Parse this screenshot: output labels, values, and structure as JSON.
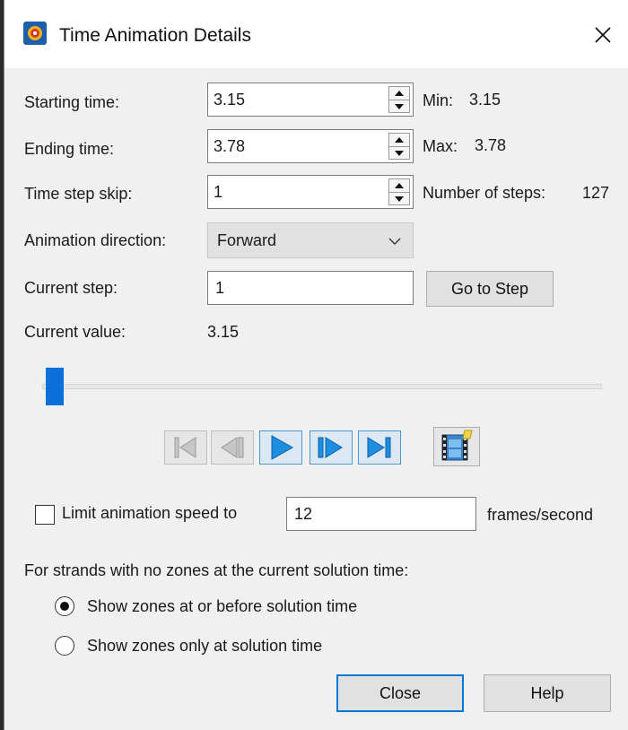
{
  "window": {
    "title": "Time Animation Details",
    "close_icon": "close-icon"
  },
  "fields": {
    "starting_time_label": "Starting time:",
    "starting_time_value": "3.15",
    "min_label": "Min:",
    "min_value": "3.15",
    "ending_time_label": "Ending time:",
    "ending_time_value": "3.78",
    "max_label": "Max:",
    "max_value": "3.78",
    "time_step_skip_label": "Time step skip:",
    "time_step_skip_value": "1",
    "num_steps_label": "Number of steps:",
    "num_steps_value": "127",
    "direction_label": "Animation direction:",
    "direction_value": "Forward",
    "current_step_label": "Current step:",
    "current_step_value": "1",
    "go_to_step_label": "Go to Step",
    "current_value_label": "Current value:",
    "current_value_value": "3.15"
  },
  "slider": {
    "position_fraction": 0.0
  },
  "playback": {
    "buttons": [
      {
        "name": "go-to-start-button",
        "enabled": false
      },
      {
        "name": "step-back-button",
        "enabled": false
      },
      {
        "name": "play-button",
        "enabled": true
      },
      {
        "name": "step-forward-button",
        "enabled": true
      },
      {
        "name": "go-to-end-button",
        "enabled": true
      }
    ],
    "export_movie_icon": "film-export-icon"
  },
  "speed": {
    "checkbox_label": "Limit animation speed to",
    "checked": false,
    "fps_value": "12",
    "fps_unit": "frames/second"
  },
  "strands": {
    "heading": "For strands with no zones at the current solution time:",
    "option_before": "Show zones at or before solution time",
    "option_only": "Show zones only at solution time",
    "selected": "option_before"
  },
  "footer": {
    "close_label": "Close",
    "help_label": "Help"
  },
  "colors": {
    "accent": "#0a6fd8",
    "default_button_border": "#0078d7"
  }
}
